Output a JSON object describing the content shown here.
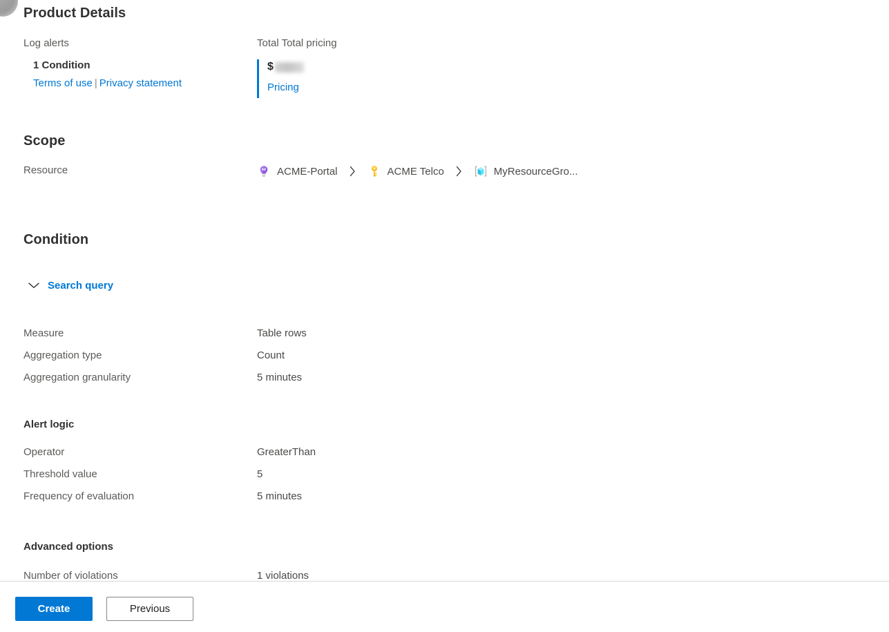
{
  "product_details": {
    "title": "Product Details",
    "offer_label": "Log alerts",
    "condition_summary": "1 Condition",
    "terms_link": "Terms of use",
    "legal_separator": "|",
    "privacy_link": "Privacy statement",
    "pricing_heading": "Total Total pricing",
    "currency_symbol": "$",
    "pricing_link": "Pricing",
    "accent_color": "#0078d4"
  },
  "scope": {
    "title": "Scope",
    "resource_label": "Resource",
    "breadcrumb": [
      {
        "label": "ACME-Portal",
        "icon": "lightbulb-icon"
      },
      {
        "label": "ACME Telco",
        "icon": "key-icon"
      },
      {
        "label": "MyResourceGro...",
        "icon": "resource-group-icon"
      }
    ]
  },
  "condition": {
    "title": "Condition",
    "search_query_label": "Search query",
    "search_query_icon": "chevron-down-icon",
    "measure_rows": [
      {
        "label": "Measure",
        "value": "Table rows"
      },
      {
        "label": "Aggregation type",
        "value": "Count"
      },
      {
        "label": "Aggregation granularity",
        "value": "5 minutes"
      }
    ],
    "alert_logic_title": "Alert logic",
    "alert_logic_rows": [
      {
        "label": "Operator",
        "value": "GreaterThan"
      },
      {
        "label": "Threshold value",
        "value": "5"
      },
      {
        "label": "Frequency of evaluation",
        "value": "5 minutes"
      }
    ],
    "advanced_title": "Advanced options",
    "advanced_rows": [
      {
        "label": "Number of violations",
        "value": "1 violations"
      }
    ]
  },
  "footer": {
    "create_label": "Create",
    "previous_label": "Previous"
  }
}
